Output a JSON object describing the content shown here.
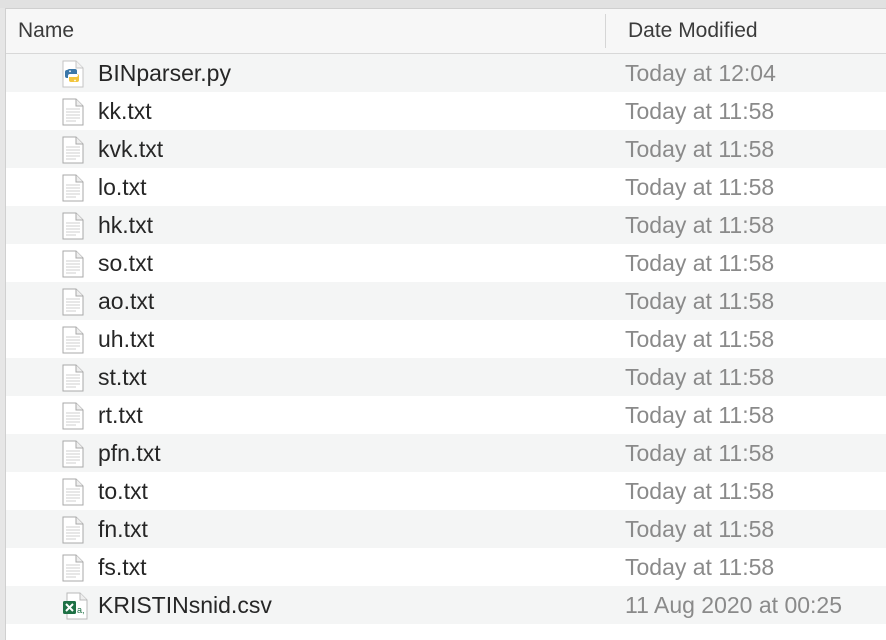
{
  "header": {
    "name_label": "Name",
    "date_label": "Date Modified"
  },
  "files": [
    {
      "name": "BINparser.py",
      "date": "Today at 12:04",
      "icon": "python-file-icon"
    },
    {
      "name": "kk.txt",
      "date": "Today at 11:58",
      "icon": "text-file-icon"
    },
    {
      "name": "kvk.txt",
      "date": "Today at 11:58",
      "icon": "text-file-icon"
    },
    {
      "name": "lo.txt",
      "date": "Today at 11:58",
      "icon": "text-file-icon"
    },
    {
      "name": "hk.txt",
      "date": "Today at 11:58",
      "icon": "text-file-icon"
    },
    {
      "name": "so.txt",
      "date": "Today at 11:58",
      "icon": "text-file-icon"
    },
    {
      "name": "ao.txt",
      "date": "Today at 11:58",
      "icon": "text-file-icon"
    },
    {
      "name": "uh.txt",
      "date": "Today at 11:58",
      "icon": "text-file-icon"
    },
    {
      "name": "st.txt",
      "date": "Today at 11:58",
      "icon": "text-file-icon"
    },
    {
      "name": "rt.txt",
      "date": "Today at 11:58",
      "icon": "text-file-icon"
    },
    {
      "name": "pfn.txt",
      "date": "Today at 11:58",
      "icon": "text-file-icon"
    },
    {
      "name": "to.txt",
      "date": "Today at 11:58",
      "icon": "text-file-icon"
    },
    {
      "name": "fn.txt",
      "date": "Today at 11:58",
      "icon": "text-file-icon"
    },
    {
      "name": "fs.txt",
      "date": "Today at 11:58",
      "icon": "text-file-icon"
    },
    {
      "name": "KRISTINsnid.csv",
      "date": "11 Aug 2020 at 00:25",
      "icon": "excel-csv-file-icon"
    }
  ],
  "colors": {
    "row_alt": "#f4f5f5",
    "python_blue": "#3b77a8",
    "python_yellow": "#f2c53d",
    "excel_green": "#1e7145"
  }
}
